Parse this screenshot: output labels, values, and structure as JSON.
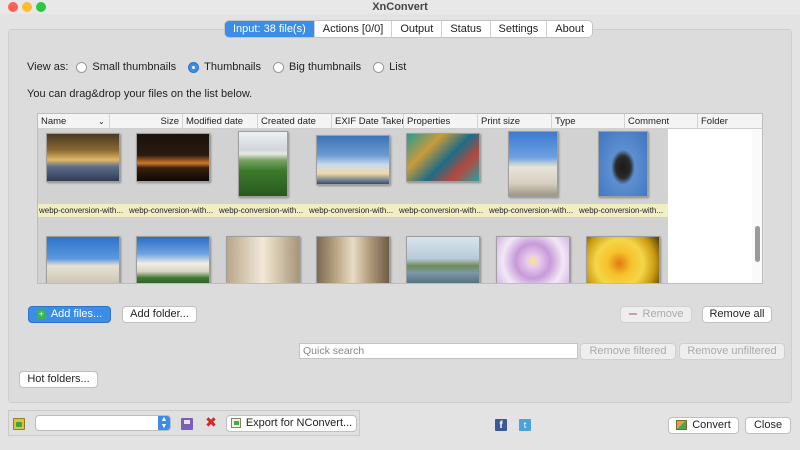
{
  "window": {
    "title": "XnConvert"
  },
  "tabs": [
    {
      "label": "Input: 38 file(s)",
      "active": true
    },
    {
      "label": "Actions [0/0]"
    },
    {
      "label": "Output"
    },
    {
      "label": "Status"
    },
    {
      "label": "Settings"
    },
    {
      "label": "About"
    }
  ],
  "view_as": {
    "label": "View as:",
    "options": [
      "Small thumbnails",
      "Thumbnails",
      "Big thumbnails",
      "List"
    ],
    "selected": "Thumbnails"
  },
  "drag_hint": "You can drag&drop your files on the list below.",
  "columns": [
    "Name",
    "Size",
    "Modified date",
    "Created date",
    "EXIF Date Taken",
    "Properties",
    "Print size",
    "Type",
    "Comment",
    "Folder"
  ],
  "thumbnails": [
    {
      "caption": "webp-conversion-with...",
      "subject": "library-hall"
    },
    {
      "caption": "webp-conversion-with...",
      "subject": "night-skyline"
    },
    {
      "caption": "webp-conversion-with...",
      "subject": "capitol-lawn"
    },
    {
      "caption": "webp-conversion-with...",
      "subject": "monument-sky"
    },
    {
      "caption": "webp-conversion-with...",
      "subject": "mosaic"
    },
    {
      "caption": "webp-conversion-with...",
      "subject": "capitol-dome"
    },
    {
      "caption": "webp-conversion-with...",
      "subject": "eagle-statue"
    },
    {
      "caption": "",
      "subject": "statue-dome"
    },
    {
      "caption": "",
      "subject": "capitol-building"
    },
    {
      "caption": "",
      "subject": "lincoln-statue"
    },
    {
      "caption": "",
      "subject": "lincoln-seated"
    },
    {
      "caption": "",
      "subject": "reflecting-pool"
    },
    {
      "caption": "",
      "subject": "purple-flower"
    },
    {
      "caption": "",
      "subject": "yellow-flower"
    }
  ],
  "buttons": {
    "add_files": "Add files...",
    "add_folder": "Add folder...",
    "remove": "Remove",
    "remove_all": "Remove all",
    "remove_filtered": "Remove filtered",
    "remove_unfiltered": "Remove unfiltered",
    "hot_folders": "Hot folders...",
    "export": "Export for NConvert...",
    "convert": "Convert",
    "close": "Close"
  },
  "search": {
    "placeholder": "Quick search",
    "value": ""
  },
  "social": {
    "facebook": "f",
    "twitter": "t"
  },
  "colors": {
    "accent": "#3b8de8",
    "caption_bg": "#f2eec4",
    "facebook": "#3b5998",
    "twitter": "#4aa3df"
  }
}
